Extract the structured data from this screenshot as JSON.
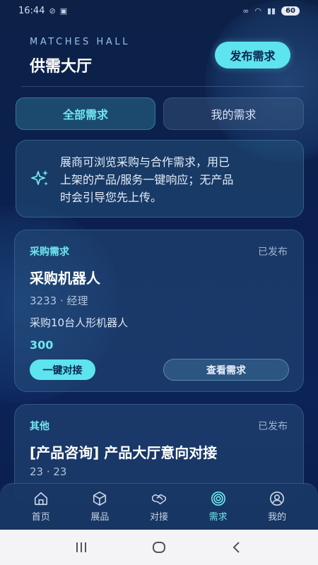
{
  "status_bar": {
    "time": "16:44",
    "battery": "60"
  },
  "header": {
    "subtitle_en": "MATCHES HALL",
    "title": "供需大厅",
    "publish_label": "发布需求"
  },
  "tabs": [
    {
      "label": "全部需求",
      "active": true
    },
    {
      "label": "我的需求",
      "active": false
    }
  ],
  "info": {
    "line1": "展商可浏览采购与合作需求，用已",
    "line2": "上架的产品/服务一键响应；无产品",
    "line3": "时会引导您先上传。"
  },
  "demands": [
    {
      "type": "采购需求",
      "status": "已发布",
      "title": "采购机器人",
      "meta": "3233 · 经理",
      "desc": "采购10台人形机器人",
      "price": "300",
      "match_label": "一键对接",
      "view_label": "查看需求"
    },
    {
      "type": "其他",
      "status": "已发布",
      "title": "[产品咨询] 产品大厅意向对接",
      "meta": "23 · 23"
    }
  ],
  "nav": [
    {
      "label": "首页",
      "icon": "home-icon"
    },
    {
      "label": "展品",
      "icon": "box-icon"
    },
    {
      "label": "对接",
      "icon": "handshake-icon"
    },
    {
      "label": "需求",
      "icon": "target-icon",
      "active": true
    },
    {
      "label": "我的",
      "icon": "user-icon"
    }
  ],
  "colors": {
    "accent": "#5ee4ee",
    "background": "#0d2147",
    "card": "#28507d"
  }
}
